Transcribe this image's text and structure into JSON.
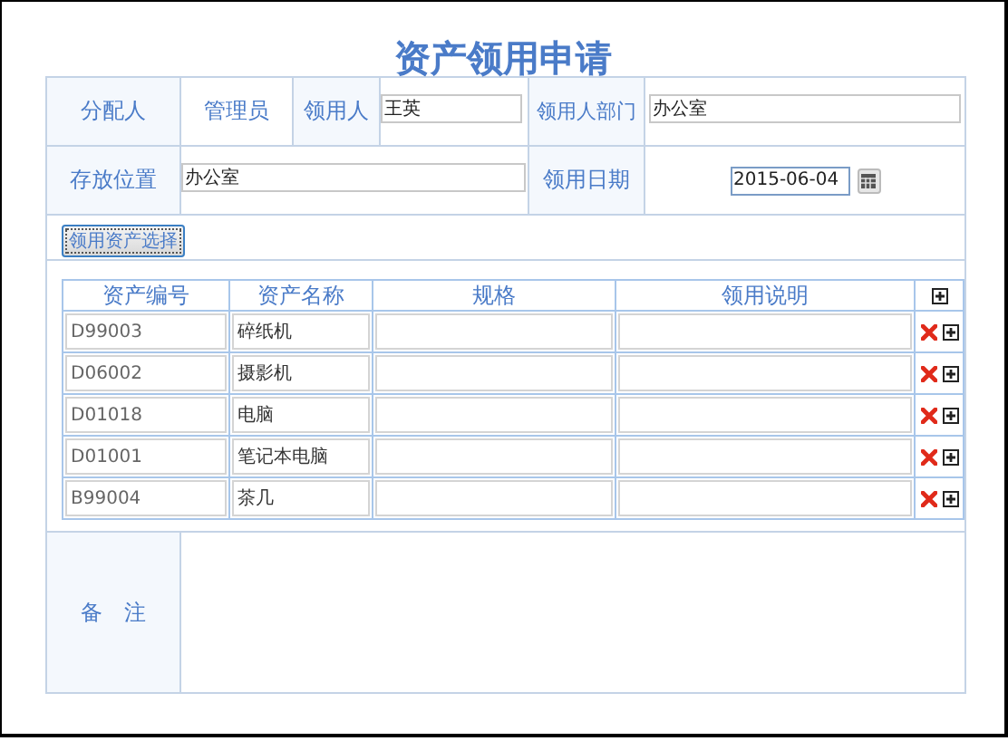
{
  "title": "资产领用申请",
  "form": {
    "assigner_label": "分配人",
    "assigner": "管理员",
    "recipient_label": "领用人",
    "recipient": "王英",
    "department_label": "领用人部门",
    "department": "办公室",
    "location_label": "存放位置",
    "location": "办公室",
    "date_label": "领用日期",
    "date": "2015-06-04"
  },
  "select_button": "领用资产选择",
  "items": {
    "columns": [
      "资产编号",
      "资产名称",
      "规格",
      "领用说明"
    ],
    "rows": [
      {
        "code": "D99003",
        "name": "碎纸机"
      },
      {
        "code": "D06002",
        "name": "摄影机"
      },
      {
        "code": "D01018",
        "name": "电脑"
      },
      {
        "code": "D01001",
        "name": "笔记本电脑"
      },
      {
        "code": "B99004",
        "name": "茶几"
      }
    ]
  },
  "remark": {
    "label": "备　注"
  }
}
